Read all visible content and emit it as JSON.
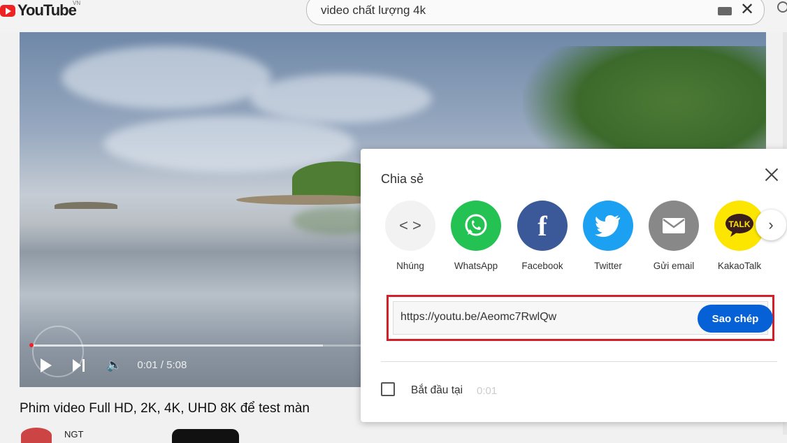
{
  "header": {
    "logo_text": "YouTube",
    "country_code": "VN",
    "search_value": "video chất lượng 4k"
  },
  "player": {
    "time_display": "0:01 / 5:08",
    "progress_fraction": 0.0032
  },
  "video": {
    "title": "Phim video Full HD, 2K, 4K, UHD 8K để test màn",
    "channel_name": "NGT"
  },
  "share_dialog": {
    "title": "Chia sẻ",
    "targets": [
      {
        "label": "Nhúng",
        "icon": "embed-icon"
      },
      {
        "label": "WhatsApp",
        "icon": "whatsapp-icon"
      },
      {
        "label": "Facebook",
        "icon": "facebook-icon"
      },
      {
        "label": "Twitter",
        "icon": "twitter-icon"
      },
      {
        "label": "Gửi email",
        "icon": "email-icon"
      },
      {
        "label": "KakaoTalk",
        "icon": "kakaotalk-icon"
      }
    ],
    "url": "https://youtu.be/Aeomc7RwlQw",
    "copy_label": "Sao chép",
    "start_at_label": "Bắt đầu tại",
    "start_at_time": "0:01"
  },
  "colors": {
    "copy_button": "#0661d6",
    "highlight_border": "#d32028",
    "whatsapp": "#23c253",
    "facebook": "#3b5998",
    "twitter": "#1ca1f2",
    "kakaotalk": "#fce600"
  }
}
